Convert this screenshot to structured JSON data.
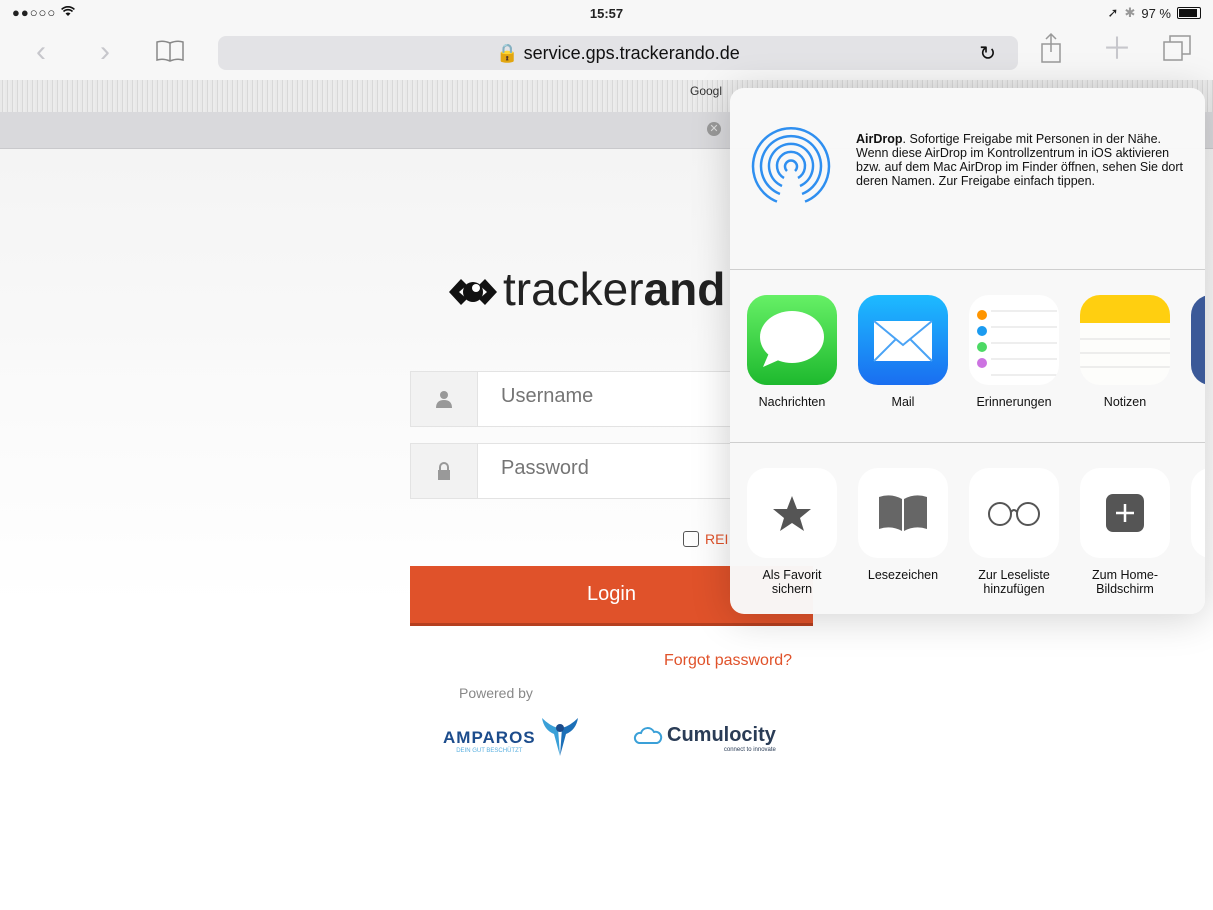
{
  "status_bar": {
    "signal": "●●○○○",
    "time": "15:57",
    "battery_percent": "97 %"
  },
  "toolbar": {
    "url": "service.gps.trackerando.de"
  },
  "bookmarks": {
    "partial_label": "Googl"
  },
  "login": {
    "brand_prefix": "tracker",
    "brand_suffix": "and",
    "username_placeholder": "Username",
    "password_placeholder": "Password",
    "remember_label": "REI",
    "login_label": "Login",
    "forgot_label": "Forgot password?",
    "powered_by": "Powered by",
    "partner1": "AMPAROS",
    "partner1_tagline": "DEIN GUT BESCHÜTZT",
    "partner2": "Cumulocity",
    "partner2_tagline": "connect to innovate",
    "accent": "#e0522a"
  },
  "share_sheet": {
    "airdrop_title": "AirDrop",
    "airdrop_text": ". Sofortige Freigabe mit Personen in der Nähe. Wenn diese AirDrop im Kontrollzentrum in iOS aktivieren bzw. auf dem Mac AirDrop im Finder öffnen, sehen Sie dort deren Namen. Zur Freigabe einfach tippen.",
    "apps": [
      {
        "label": "Nachrichten",
        "icon": "messages-icon"
      },
      {
        "label": "Mail",
        "icon": "mail-icon"
      },
      {
        "label": "Erinnerungen",
        "icon": "reminders-icon"
      },
      {
        "label": "Notizen",
        "icon": "notes-icon"
      }
    ],
    "actions": [
      {
        "label": "Als Favorit sichern",
        "icon": "star-icon"
      },
      {
        "label": "Lesezeichen",
        "icon": "book-icon"
      },
      {
        "label": "Zur Leseliste hinzufügen",
        "icon": "glasses-icon"
      },
      {
        "label": "Zum Home-Bildschirm",
        "icon": "add-home-icon"
      }
    ]
  }
}
